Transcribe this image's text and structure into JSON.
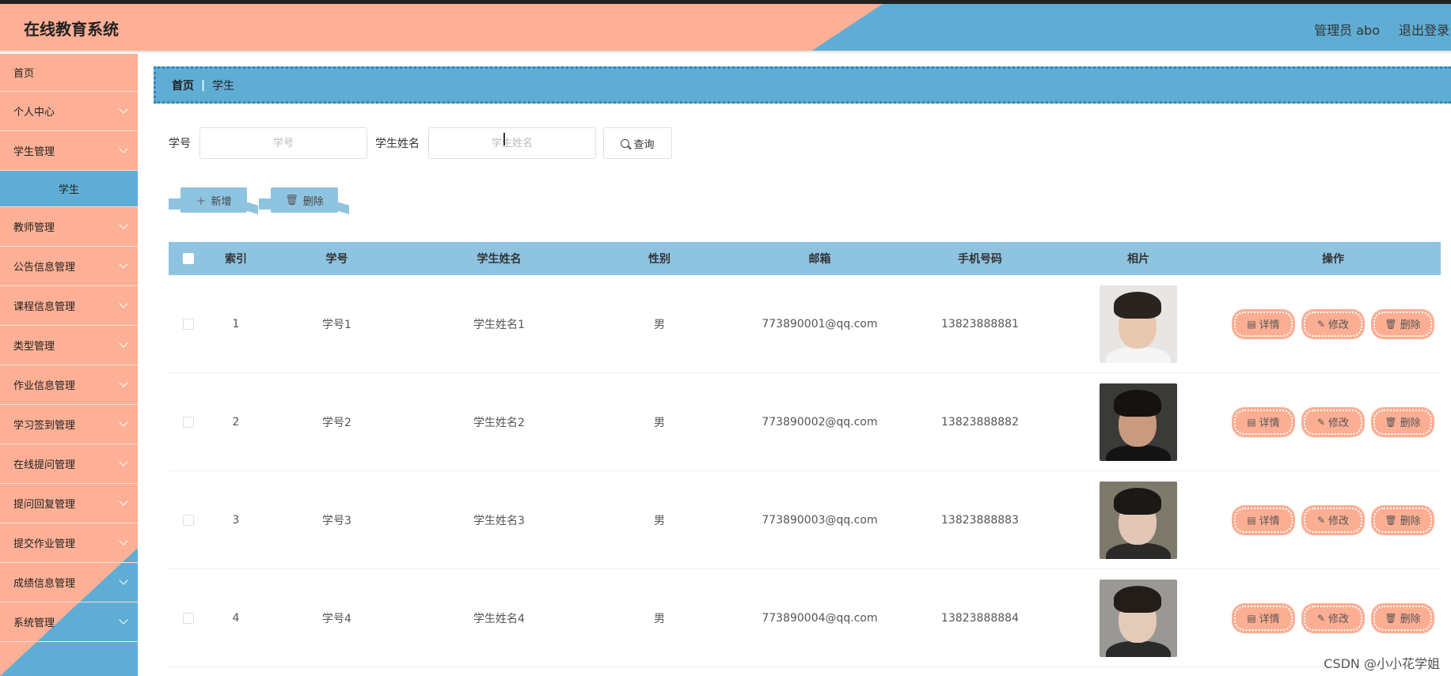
{
  "app": {
    "title": "在线教育系统"
  },
  "header": {
    "admin_label": "管理员 abo",
    "logout_label": "退出登录"
  },
  "sidebar": {
    "items": [
      {
        "label": "首页",
        "expandable": false
      },
      {
        "label": "个人中心",
        "expandable": true
      },
      {
        "label": "学生管理",
        "expandable": true
      },
      {
        "label": "学生",
        "sub": true
      },
      {
        "label": "教师管理",
        "expandable": true
      },
      {
        "label": "公告信息管理",
        "expandable": true
      },
      {
        "label": "课程信息管理",
        "expandable": true
      },
      {
        "label": "类型管理",
        "expandable": true
      },
      {
        "label": "作业信息管理",
        "expandable": true
      },
      {
        "label": "学习签到管理",
        "expandable": true
      },
      {
        "label": "在线提问管理",
        "expandable": true
      },
      {
        "label": "提问回复管理",
        "expandable": true
      },
      {
        "label": "提交作业管理",
        "expandable": true
      },
      {
        "label": "成绩信息管理",
        "expandable": true
      },
      {
        "label": "系统管理",
        "expandable": true
      }
    ]
  },
  "breadcrumb": {
    "home": "首页",
    "separator": "|",
    "current": "学生"
  },
  "search": {
    "no_label": "学号",
    "no_placeholder": "学号",
    "no_value": "",
    "name_label": "学生姓名",
    "name_placeholder": "学生姓名",
    "name_value": "",
    "query_label": "查询"
  },
  "toolbar": {
    "add_label": "新增",
    "delete_label": "删除"
  },
  "table": {
    "headers": {
      "index": "索引",
      "no": "学号",
      "name": "学生姓名",
      "sex": "性别",
      "email": "邮箱",
      "phone": "手机号码",
      "photo": "相片",
      "ops": "操作"
    },
    "ops": {
      "detail": "详情",
      "edit": "修改",
      "delete": "删除"
    },
    "rows": [
      {
        "index": "1",
        "no": "学号1",
        "name": "学生姓名1",
        "sex": "男",
        "email": "773890001@qq.com",
        "phone": "13823888881"
      },
      {
        "index": "2",
        "no": "学号2",
        "name": "学生姓名2",
        "sex": "男",
        "email": "773890002@qq.com",
        "phone": "13823888882"
      },
      {
        "index": "3",
        "no": "学号3",
        "name": "学生姓名3",
        "sex": "男",
        "email": "773890003@qq.com",
        "phone": "13823888883"
      },
      {
        "index": "4",
        "no": "学号4",
        "name": "学生姓名4",
        "sex": "男",
        "email": "773890004@qq.com",
        "phone": "13823888884"
      }
    ]
  },
  "watermark": "CSDN @小小花学姐",
  "colors": {
    "salmon": "#fdb095",
    "blue": "#5fadd5",
    "light_blue": "#8fc4e0"
  }
}
